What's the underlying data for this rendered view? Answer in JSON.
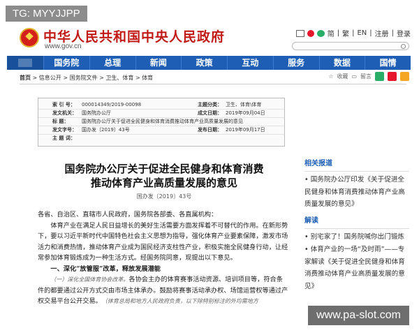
{
  "watermark": {
    "top": "TG: MYYJJPP",
    "bottom": "www.pa-slot.com"
  },
  "header": {
    "site_title": "中华人民共和国中央人民政府",
    "site_url": "www.gov.cn",
    "links": [
      "简",
      "繁",
      "EN",
      "注册",
      "登录"
    ],
    "separator": "|"
  },
  "nav": {
    "items": [
      "国务院",
      "总理",
      "新闻",
      "政策",
      "互动",
      "服务",
      "数据",
      "国情"
    ]
  },
  "breadcrumb": {
    "home": "首页",
    "items": [
      "信息公开",
      "国务院文件",
      "卫生、体育",
      "体育"
    ],
    "sep": ">"
  },
  "share": {
    "favorite": "收藏",
    "print": "留言"
  },
  "meta": {
    "rows": [
      {
        "l1": "索 引 号：",
        "v1": "000014349/2019-00098",
        "l2": "主题分类：",
        "v2": "卫生、体育\\体育"
      },
      {
        "l1": "发文机关：",
        "v1": "国务院办公厅",
        "l2": "成文日期：",
        "v2": "2019年09月04日"
      },
      {
        "l1": "标    题：",
        "v1": "国务院办公厅关于促进全民健身和体育消费推动体育产业高质量发展的意见",
        "l2": "",
        "v2": ""
      },
      {
        "l1": "发文字号：",
        "v1": "国办发〔2019〕43号",
        "l2": "发布日期：",
        "v2": "2019年09月17日"
      },
      {
        "l1": "主 题 词：",
        "v1": "",
        "l2": "",
        "v2": ""
      }
    ]
  },
  "doc": {
    "title_line1": "国务院办公厅关于促进全民健身和体育消费",
    "title_line2": "推动体育产业高质量发展的意见",
    "number": "国办发〔2019〕43号",
    "addressee": "各省、自治区、直辖市人民政府，国务院各部委、各直属机构：",
    "para1": "体育产业在满足人民日益增长的美好生活需要方面发挥着不可替代的作用。在新形势下，要以习近平新时代中国特色社会主义思想为指导，强化体育产业要素保障，激发市场活力和消费热情，推动体育产业成为国民经济支柱性产业，积极实施全民健身行动，让经常参加体育锻炼成为一种生活方式。经国务院同意，现提出以下意见。",
    "section1": "一、深化“放管服”改革，释放发展潜能",
    "para2_title": "（一）深化全国体育协会改革。",
    "para2": "各协会主办的体育赛事活动资源、培训项目等，符合条件的都要通过公开方式交由市场主体承办。鼓励将赛事活动承办权、场馆运营权等通过产权交易平台公开交易。",
    "para2_note": "（体育总局和地方人民政府负责，以下除特别标注的外均需地方"
  },
  "sidebar": {
    "related_title": "相关报道",
    "related_items": [
      "国务院办公厅印发《关于促进全民健身和体育消费推动体育产业高质量发展的意见》"
    ],
    "explain_title": "解读",
    "explain_items": [
      "别宅家了！国务院喊你出门锻炼",
      "体育产业的一场“及时雨”——专家解读《关于促进全民健身和体育消费推动体育产业高质量发展的意见》"
    ]
  }
}
